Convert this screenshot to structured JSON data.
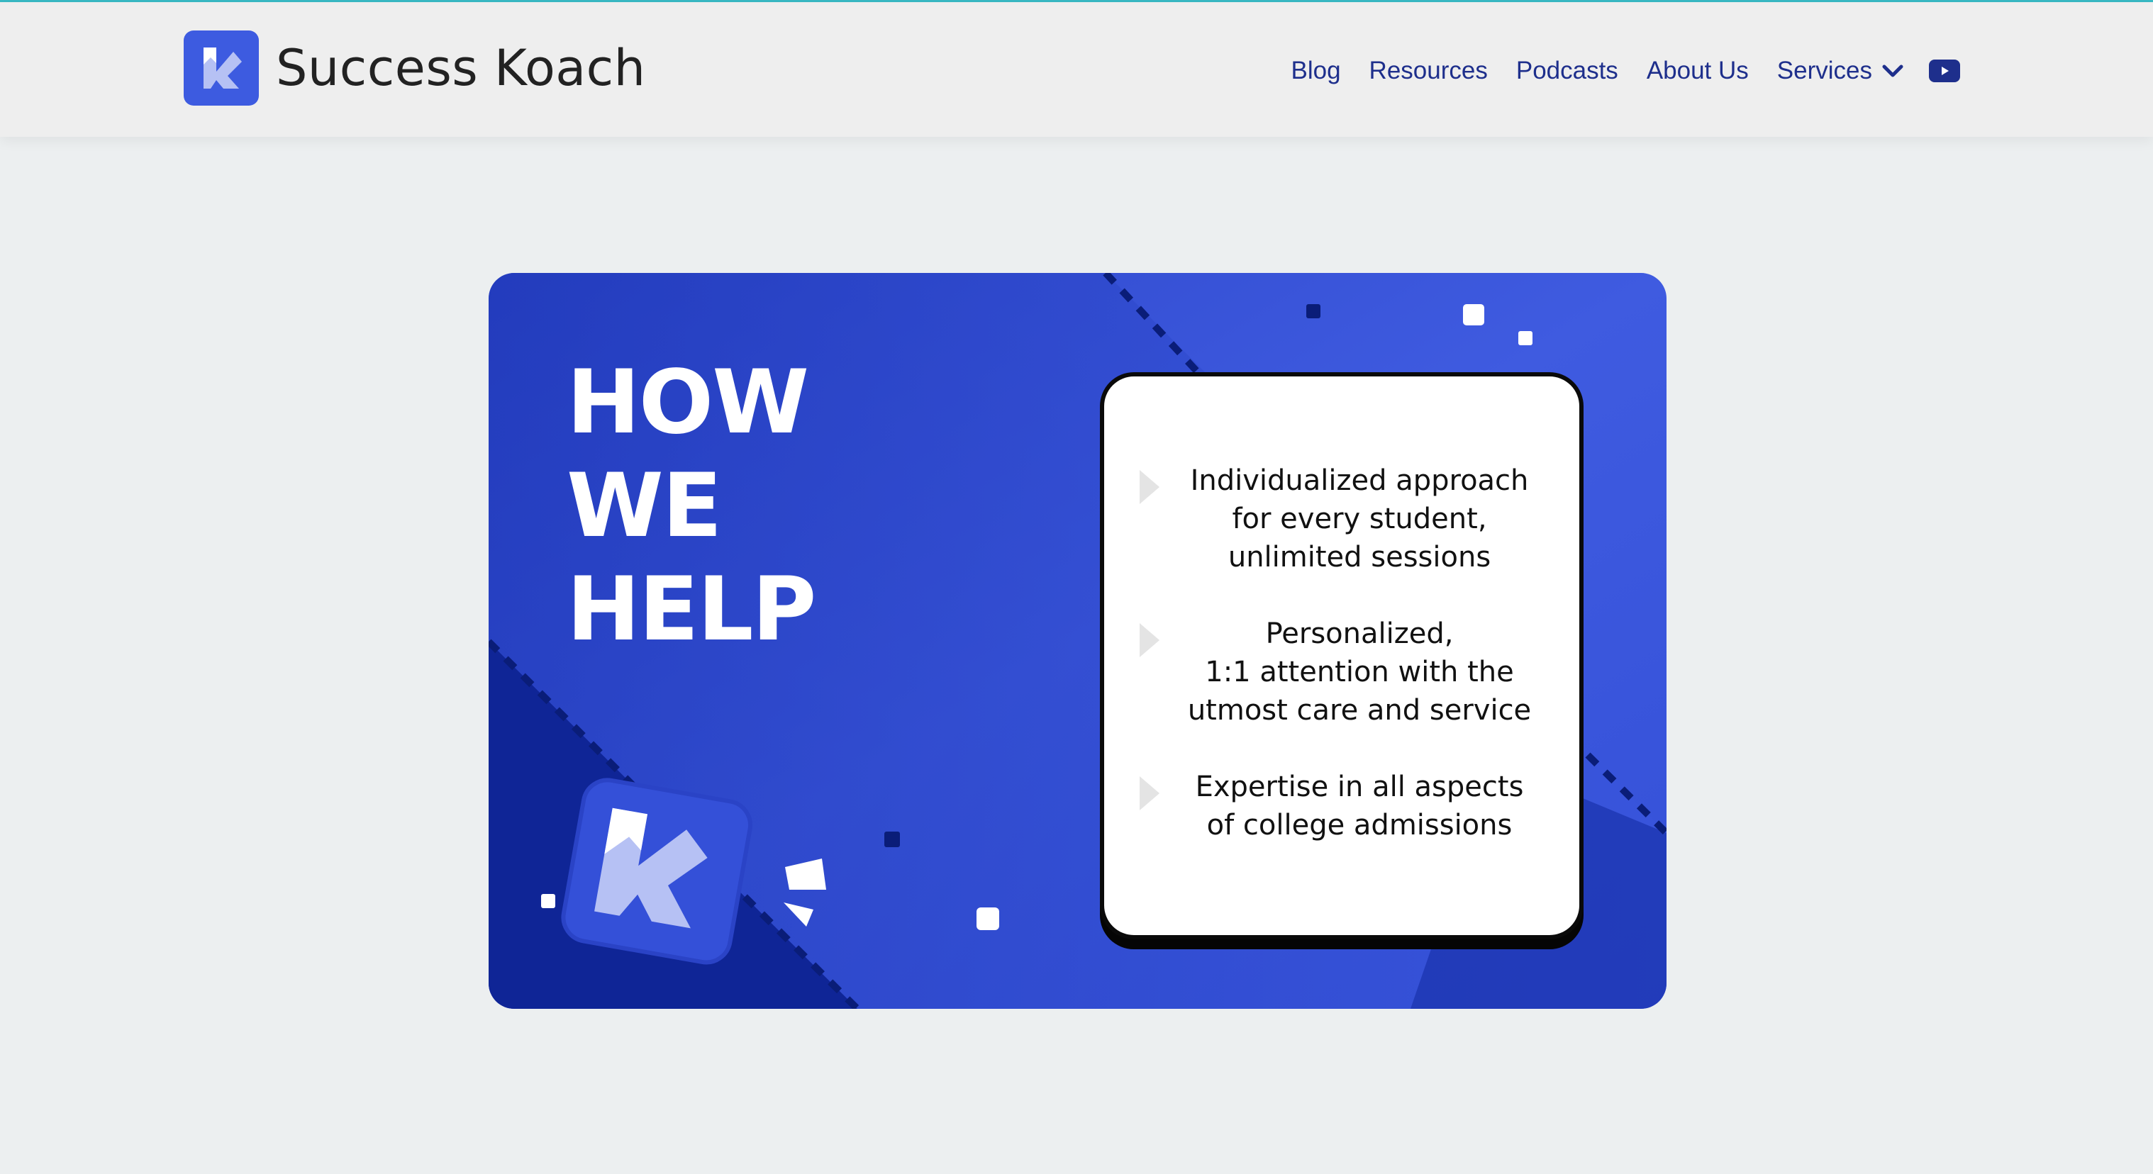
{
  "brand": {
    "name": "Success Koach",
    "accent_color": "#3d5be0",
    "nav_color": "#1e2f8c"
  },
  "nav": {
    "items": [
      {
        "label": "Blog"
      },
      {
        "label": "Resources"
      },
      {
        "label": "Podcasts"
      },
      {
        "label": "About Us"
      },
      {
        "label": "Services"
      }
    ],
    "services_dropdown_icon": "chevron-down-icon",
    "social_icon": "youtube-icon"
  },
  "hero": {
    "title_lines": [
      "HOW",
      "WE",
      "HELP"
    ],
    "points": [
      "Individualized approach for every student, unlimited sessions",
      "Personalized, 1:1 attention with the utmost care and service",
      "Expertise in all aspects of college admissions"
    ],
    "point_lines": [
      [
        "Individualized approach",
        "for every student,",
        "unlimited sessions"
      ],
      [
        "Personalized,",
        "1:1 attention with the",
        "utmost care and service"
      ],
      [
        "Expertise in all aspects",
        "of college admissions"
      ]
    ],
    "bg_color": "#3a55db",
    "bg_dark_color": "#0f2596"
  }
}
